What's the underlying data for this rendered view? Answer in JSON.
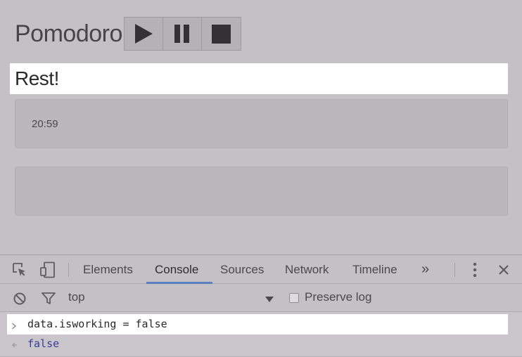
{
  "app": {
    "title": "Pomodoro",
    "state_text": "Rest!",
    "timer": "20:59",
    "controls": [
      "play-icon",
      "pause-icon",
      "stop-icon"
    ],
    "accent": "#474547"
  },
  "devtools": {
    "tabs": [
      {
        "label": "Elements"
      },
      {
        "label": "Console"
      },
      {
        "label": "Sources"
      },
      {
        "label": "Network"
      },
      {
        "label": "Timeline"
      }
    ],
    "active_tab": "Console",
    "more_tabs_label": "»",
    "context": "top",
    "preserve_log_label": "Preserve log",
    "preserve_log_checked": false,
    "console_input": "data.isworking = false",
    "console_result": "false",
    "active_tab_color": "#5a7fbf",
    "result_color": "#3a3a9e"
  }
}
